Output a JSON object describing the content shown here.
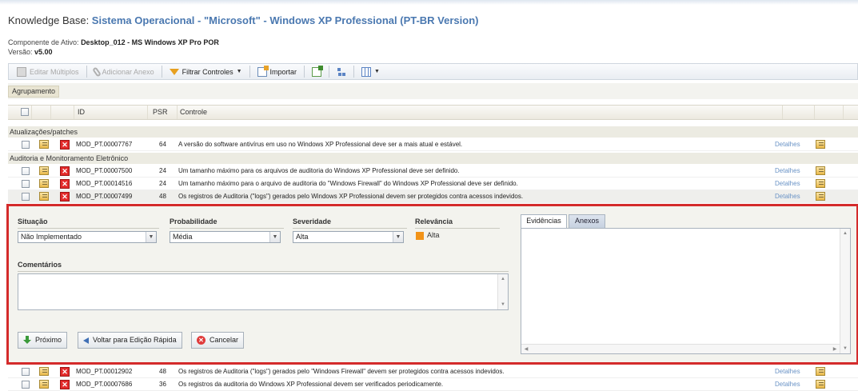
{
  "header": {
    "prefix": "Knowledge Base: ",
    "kb_name": "Sistema Operacional - \"Microsoft\" - Windows XP Professional (PT-BR Version)",
    "asset_label": "Componente de Ativo: ",
    "asset_value": "Desktop_012 - MS Windows XP Pro POR",
    "version_label": "Versão: ",
    "version_value": "v5.00"
  },
  "toolbar": {
    "edit_multiple": "Editar Múltiplos",
    "add_attachment": "Adicionar Anexo",
    "filter_controls": "Filtrar Controles",
    "import": "Importar"
  },
  "grouping": {
    "label": "Agrupamento"
  },
  "grid": {
    "headers": {
      "id": "ID",
      "psr": "PSR",
      "control": "Controle"
    },
    "groups": [
      "Atualizações/patches",
      "Auditoria e Monitoramento Eletrônico"
    ],
    "details_label": "Detalhes",
    "rows": [
      {
        "id": "MOD_PT.00007767",
        "psr": "64",
        "control": "A versão do software antivírus em uso no Windows XP Professional deve ser a mais atual e estável."
      },
      {
        "id": "MOD_PT.00007500",
        "psr": "24",
        "control": "Um tamanho máximo para os arquivos de auditoria do Windows XP Professional deve ser definido."
      },
      {
        "id": "MOD_PT.00014516",
        "psr": "24",
        "control": "Um tamanho máximo para o arquivo de auditoria do \"Windows Firewall\" do Windows XP Professional deve ser definido."
      },
      {
        "id": "MOD_PT.00007499",
        "psr": "48",
        "control": "Os registros de Auditoria (\"logs\") gerados pelo Windows XP Professional devem ser protegidos contra acessos indevidos."
      },
      {
        "id": "MOD_PT.00012902",
        "psr": "48",
        "control": "Os registros de Auditoria (\"logs\") gerados pelo \"Windows Firewall\" devem ser protegidos contra acessos indevidos."
      },
      {
        "id": "MOD_PT.00007686",
        "psr": "36",
        "control": "Os registros da auditoria do Windows XP Professional devem ser verificados periodicamente."
      }
    ]
  },
  "quick_edit": {
    "situacao_label": "Situação",
    "situacao_value": "Não Implementado",
    "probabilidade_label": "Probabilidade",
    "probabilidade_value": "Média",
    "severidade_label": "Severidade",
    "severidade_value": "Alta",
    "relevancia_label": "Relevância",
    "relevancia_value": "Alta",
    "relevancia_color": "#f29318",
    "comentarios_label": "Comentários",
    "tabs": [
      "Evidências",
      "Anexos"
    ],
    "buttons": {
      "next": "Próximo",
      "back": "Voltar para Edição Rápida",
      "cancel": "Cancelar"
    },
    "highlight_color": "#d42b2b"
  }
}
